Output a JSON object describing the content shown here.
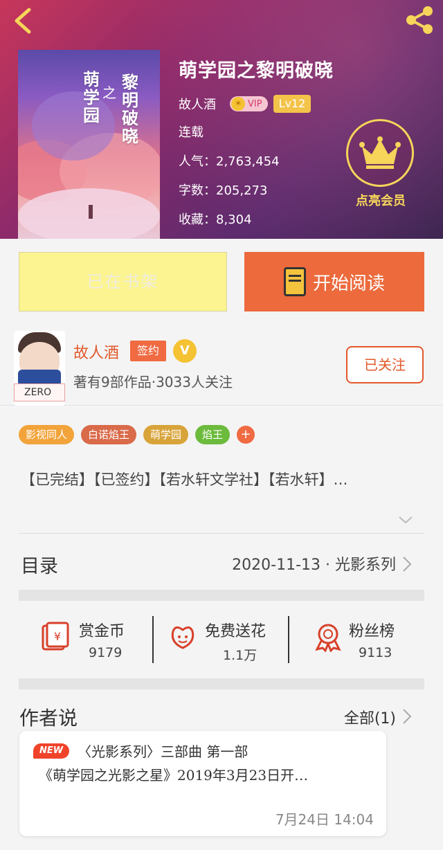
{
  "header": {
    "book_title": "萌学园之黎明破晓",
    "author": "故人酒",
    "vip_label": "VIP",
    "level": "Lv12",
    "status": "连载",
    "popularity": "人气：2,763,454",
    "word_count": "字数：205,273",
    "favorites": "收藏：8,304",
    "member_label": "点亮会员"
  },
  "cover": {
    "title_right": "黎明破晓",
    "title_left": "萌学园",
    "title_mid": "之"
  },
  "actions": {
    "shelf_label": "已在书架",
    "read_label": "开始阅读"
  },
  "author_card": {
    "name": "故人酒",
    "sign_label": "签约",
    "v_label": "V",
    "stats": "著有9部作品·3033人关注",
    "follow_label": "已关注",
    "avatar_tag": "ZERO"
  },
  "tags": [
    {
      "label": "影视同人",
      "color": "#f2a33a"
    },
    {
      "label": "白诺焰王",
      "color": "#d96a4a"
    },
    {
      "label": "萌学园",
      "color": "#d8a43a"
    },
    {
      "label": "焰王",
      "color": "#6cbb3c"
    }
  ],
  "tag_more": "+",
  "description": "【已完结】【已签约】【若水轩文学社】【若水轩】…",
  "toc": {
    "label": "目录",
    "value": "2020-11-13 · 光影系列"
  },
  "stats": {
    "reward": {
      "label": "赏金币",
      "value": "9179"
    },
    "flower": {
      "label": "免费送花",
      "value": "1.1万"
    },
    "fans": {
      "label": "粉丝榜",
      "value": "9113"
    }
  },
  "author_says": {
    "title": "作者说",
    "all_label": "全部(1)",
    "new_badge": "NEW",
    "line1": "〈光影系列〉三部曲  第一部",
    "line2": "《萌学园之光影之星》2019年3月23日开…",
    "time": "7月24日   14:04"
  },
  "colors": {
    "accent_orange": "#ec6a3c",
    "shelf_yellow": "#fbf490",
    "gold": "#f6d55a"
  }
}
